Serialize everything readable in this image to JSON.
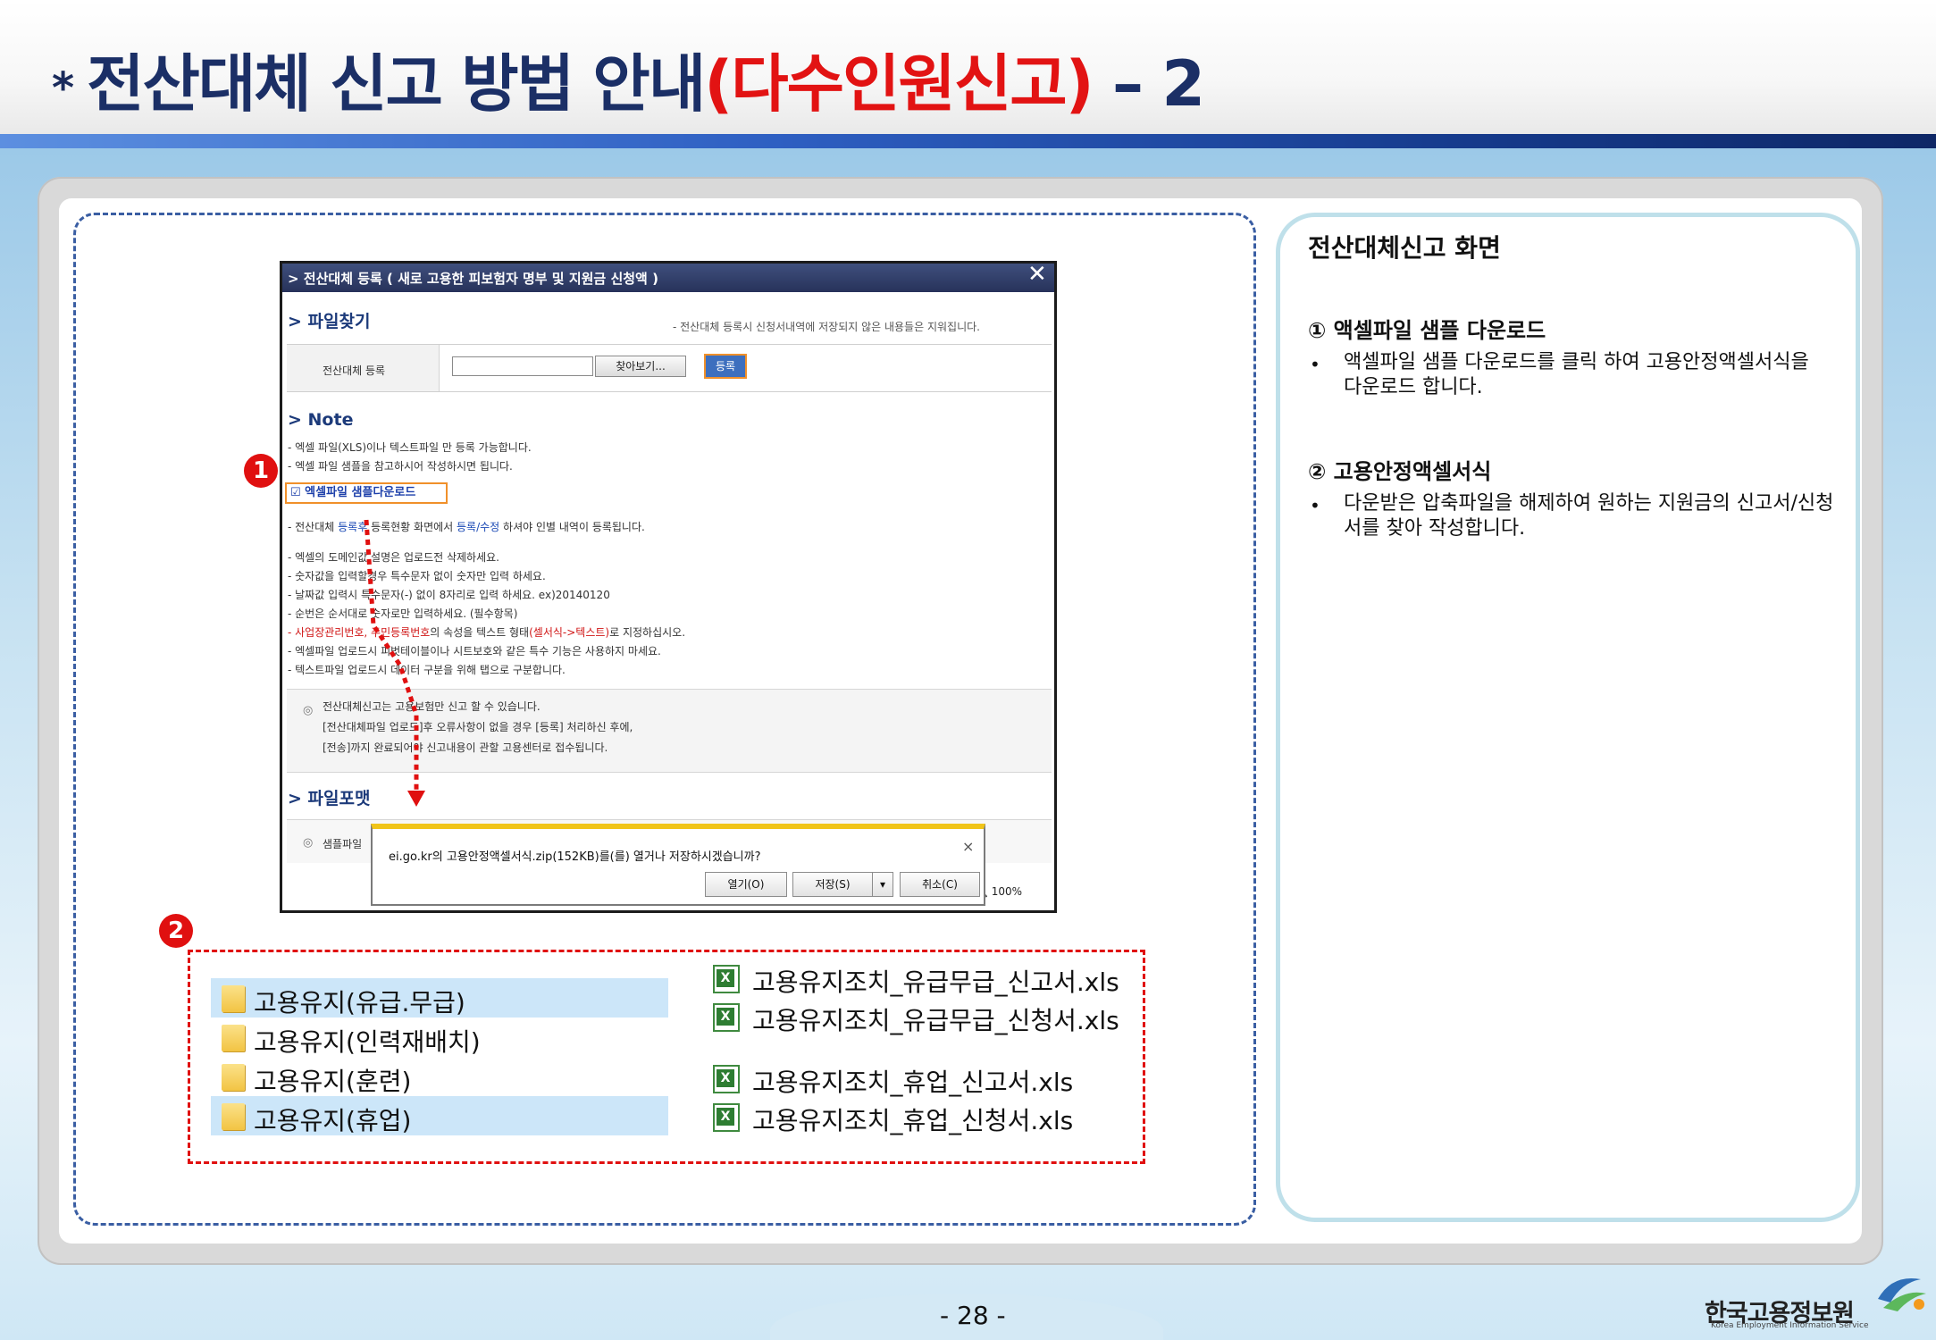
{
  "header": {
    "bullet": "*",
    "title_part1": "전산대체 신고 방법 안내",
    "title_part2": "(다수인원신고)",
    "title_part3": " – 2"
  },
  "right_panel": {
    "title": "전산대체신고 화면",
    "section1": {
      "heading": "① 액셀파일 샘플 다운로드",
      "bullet": "•",
      "text": "액셀파일 샘플 다운로드를 클릭 하여 고용안정액셀서식을 다운로드 합니다."
    },
    "section2": {
      "heading": "② 고용안정액셀서식",
      "bullet": "•",
      "text": "다운받은 압축파일을 해제하여 원하는 지원금의 신고서/신청서를 찾아 작성합니다."
    }
  },
  "dialog": {
    "title": "> 전산대체 등록 ( 새로 고용한 피보험자 명부 및 지원금 신청액 )",
    "close": "✕",
    "find_heading": "> 파일찾기",
    "find_note": "- 전산대체 등록시 신청서내역에 저장되지 않은 내용들은 지워집니다.",
    "row_label": "전산대체 등록",
    "browse_button": "찾아보기...",
    "register_button": "등록",
    "note_heading": "> Note",
    "notes_top": [
      "- 엑셀 파일(XLS)이나 텍스트파일 만 등록 가능합니다.",
      "- 엑셀 파일 샘플을 참고하시어 작성하시면 됩니다."
    ],
    "sample_link": "☑ 엑셀파일 샘플다운로드",
    "note_register_a": "- 전산대체 ",
    "note_register_b": "등록후",
    "note_register_c": " 등록현황 화면에서 ",
    "note_register_d": "등록/수정",
    "note_register_e": " 하셔야 인별 내역이 등록됩니다.",
    "notes_mid": [
      "- 엑셀의 도메인값 설명은 업로드전 삭제하세요.",
      "- 숫자값을 입력할경우 특수문자 없이 숫자만 입력 하세요.",
      "- 날짜값 입력시 특수문자(-) 없이 8자리로 입력 하세요. ex)20140120",
      "- 순번은 순서대로 숫자로만 입력하세요. (필수항목)"
    ],
    "note_red_a": "- 사업장관리번호, 주민등록번호",
    "note_red_b": "의 속성을 텍스트 형태",
    "note_red_c": "(셀서식->텍스트)",
    "note_red_d": "로 지정하십시오.",
    "notes_bottom": [
      "- 엑셀파일 업로드시 피벗테이블이나 시트보호와 같은 특수 기능은 사용하지 마세요.",
      "- 텍스트파일 업로드시 데이터 구분을 위해 탭으로 구분합니다."
    ],
    "info_icon": "◎",
    "info_lines": [
      "전산대체신고는 고용보험만 신고 할 수 있습니다.",
      "[전산대체파일 업로드]후 오류사항이 없을 경우 [등록] 처리하신 후에,",
      "[전송]까지 완료되어야 신고내용이 관할 고용센터로 접수됩니다."
    ],
    "format_heading": "> 파일포맷",
    "format_icon": "◎",
    "format_label": "샘플파일",
    "zoom": "🔍 100%"
  },
  "download_bar": {
    "message": "ei.go.kr의 고용안정액셀서식.zip(152KB)를(를) 열거나 저장하시겠습니까?",
    "close": "×",
    "open_button": "열기(O)",
    "save_button": "저장(S)",
    "save_dropdown": "▾",
    "cancel_button": "취소(C)"
  },
  "badges": {
    "one": "1",
    "two": "2"
  },
  "files": {
    "folders": [
      {
        "name": "고용유지(유급.무급)",
        "selected": true
      },
      {
        "name": "고용유지(인력재배치)",
        "selected": false
      },
      {
        "name": "고용유지(훈련)",
        "selected": false
      },
      {
        "name": "고용유지(휴업)",
        "selected": true
      }
    ],
    "xls_icon": "X",
    "xls_files": [
      "고용유지조치_유급무급_신고서.xls",
      "고용유지조치_유급무급_신청서.xls",
      "고용유지조치_휴업_신고서.xls",
      "고용유지조치_휴업_신청서.xls"
    ]
  },
  "footer": {
    "page_number": "- 28 -",
    "logo_text": "한국고용정보원",
    "logo_sub": "Korea Employment Information Service"
  },
  "colors": {
    "title_navy": "#1b2f66",
    "title_red": "#e21313",
    "accent_orange": "#f0902a",
    "badge_red": "#e01010"
  }
}
